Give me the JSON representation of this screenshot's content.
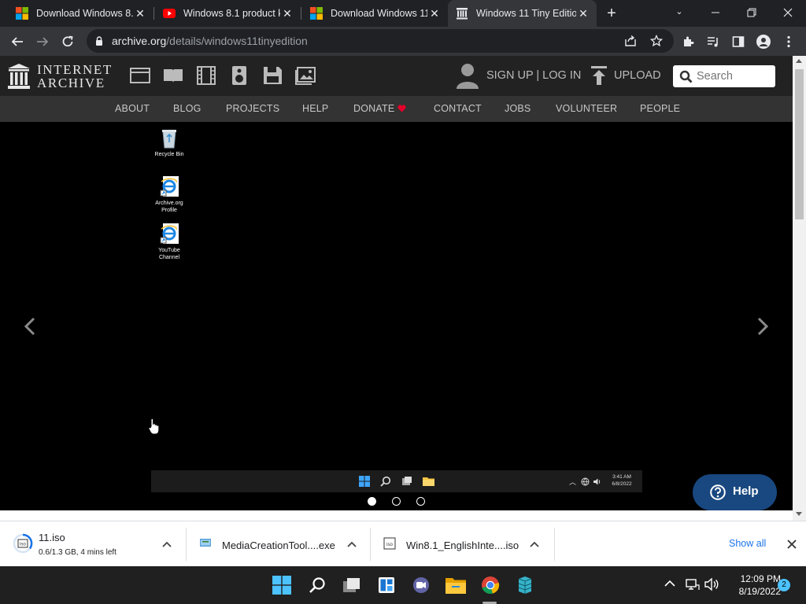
{
  "browser": {
    "tabs": [
      {
        "title": "Download Windows 8.1",
        "favicon": "microsoft-icon"
      },
      {
        "title": "Windows 8.1 product k",
        "favicon": "youtube-icon"
      },
      {
        "title": "Download Windows 11",
        "favicon": "microsoft-icon"
      },
      {
        "title": "Windows 11 Tiny Edition",
        "favicon": "internet-archive-icon",
        "active": true
      }
    ],
    "url_host": "archive.org",
    "url_path": "/details/windows11tinyedition"
  },
  "ia": {
    "logo_line1": "INTERNET",
    "logo_line2": "ARCHIVE",
    "signup": "SIGN UP | LOG IN",
    "upload": "UPLOAD",
    "search_placeholder": "Search",
    "nav": [
      "ABOUT",
      "BLOG",
      "PROJECTS",
      "HELP",
      "DONATE",
      "CONTACT",
      "JOBS",
      "VOLUNTEER",
      "PEOPLE"
    ],
    "heart_color": "#e3002a"
  },
  "screenshot": {
    "icons": [
      {
        "label": "Recycle Bin"
      },
      {
        "label": "Archive.org Profile"
      },
      {
        "label": "YouTube Channel"
      }
    ],
    "time": "3:41 AM",
    "date": "6/8/2022"
  },
  "help_button": "Help",
  "downloads": [
    {
      "name": "11.iso",
      "status": "0.6/1.3 GB, 4 mins left"
    },
    {
      "name": "MediaCreationTool....exe",
      "status": ""
    },
    {
      "name": "Win8.1_EnglishInte....iso",
      "status": ""
    }
  ],
  "show_all": "Show all",
  "taskbar": {
    "time": "12:09 PM",
    "date": "8/19/2022",
    "notifications": "2"
  }
}
